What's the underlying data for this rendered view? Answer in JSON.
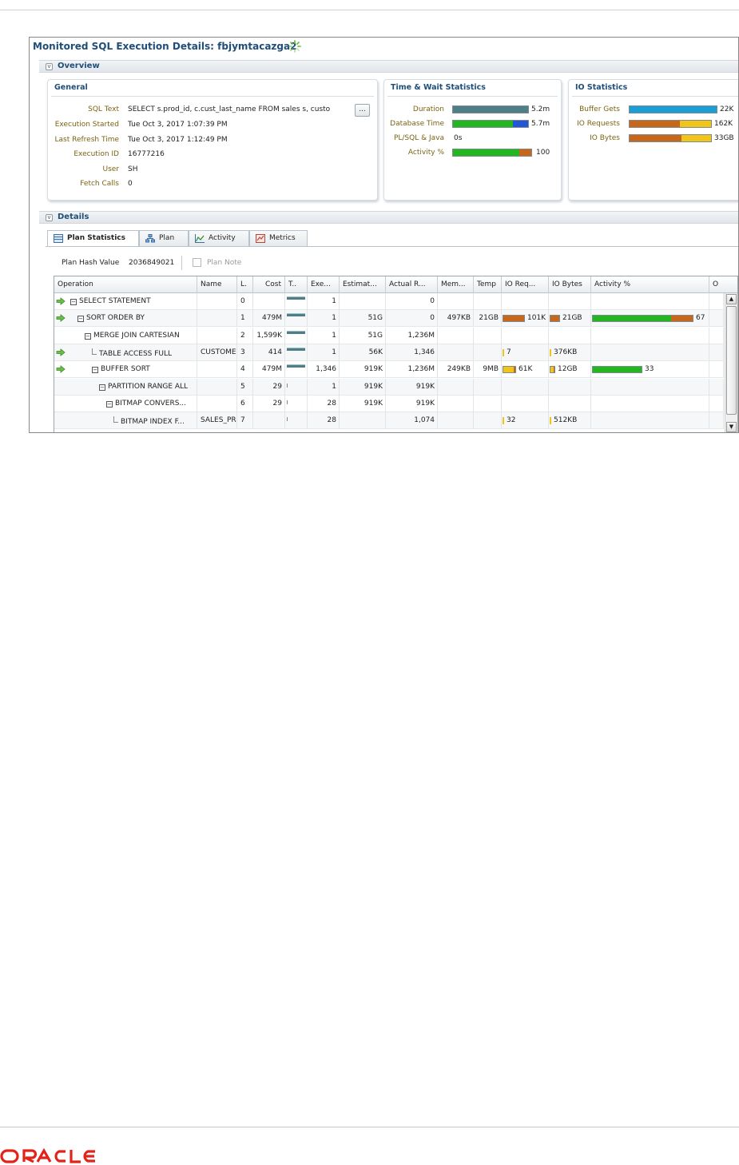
{
  "page": {
    "title": "Monitored SQL Execution Details: fbjymtacazga2",
    "overview_label": "Overview",
    "details_label": "Details"
  },
  "general": {
    "title": "General",
    "rows": [
      {
        "label": "SQL Text",
        "value": "SELECT s.prod_id, c.cust_last_name FROM sales s, custo"
      },
      {
        "label": "Execution Started",
        "value": "Tue Oct 3, 2017 1:07:39 PM"
      },
      {
        "label": "Last Refresh Time",
        "value": "Tue Oct 3, 2017 1:12:49 PM"
      },
      {
        "label": "Execution ID",
        "value": "16777216"
      },
      {
        "label": "User",
        "value": "SH"
      },
      {
        "label": "Fetch Calls",
        "value": "0"
      }
    ],
    "more_button": "..."
  },
  "time_wait": {
    "title": "Time & Wait Statistics",
    "rows": [
      {
        "label": "Duration",
        "value": "5.2m"
      },
      {
        "label": "Database Time",
        "value": "5.7m"
      },
      {
        "label": "PL/SQL & Java",
        "value": "0s"
      },
      {
        "label": "Activity %",
        "value": "100"
      }
    ]
  },
  "io_stats": {
    "title": "IO Statistics",
    "rows": [
      {
        "label": "Buffer Gets",
        "value": "22K"
      },
      {
        "label": "IO Requests",
        "value": "162K"
      },
      {
        "label": "IO Bytes",
        "value": "33GB"
      }
    ]
  },
  "colors": {
    "teal": "#4f7f86",
    "green": "#22b61f",
    "blue": "#2456d6",
    "orange": "#c8661a",
    "yellow": "#f0c419",
    "sky": "#1b9ed6"
  },
  "tabs": [
    {
      "label": "Plan Statistics",
      "icon": "table-icon"
    },
    {
      "label": "Plan",
      "icon": "tree-icon"
    },
    {
      "label": "Activity",
      "icon": "chart-icon"
    },
    {
      "label": "Metrics",
      "icon": "metrics-icon"
    }
  ],
  "plan": {
    "hash_label": "Plan Hash Value",
    "hash_value": "2036849021",
    "note_label": "Plan Note",
    "columns": [
      "Operation",
      "Name",
      "L.",
      "Cost",
      "T..",
      "Exe...",
      "Estimat...",
      "Actual R...",
      "Mem...",
      "Temp",
      "IO Req...",
      "IO Bytes",
      "Activity %",
      "O"
    ],
    "rows": [
      {
        "arrow": true,
        "tree": "box",
        "indent": 0,
        "op": "SELECT STATEMENT",
        "name": "",
        "line": "0",
        "cost": "",
        "timeline": 0.9,
        "exec": "1",
        "est": "",
        "actual": "0",
        "mem": "",
        "temp": "",
        "ioreq": "",
        "ioreq_frac": 0,
        "iobytes": "",
        "iobytes_frac": 0,
        "activity": "",
        "activity_frac": 0
      },
      {
        "arrow": true,
        "tree": "box",
        "indent": 1,
        "op": "SORT ORDER BY",
        "name": "",
        "line": "1",
        "cost": "479M",
        "timeline": 0.9,
        "exec": "1",
        "est": "51G",
        "actual": "0",
        "mem": "497KB",
        "temp": "21GB",
        "ioreq": "101K",
        "ioreq_frac": 0.62,
        "iobytes": "21GB",
        "iobytes_frac": 0.64,
        "activity": "67",
        "activity_frac": 0.67
      },
      {
        "arrow": false,
        "tree": "box",
        "indent": 2,
        "op": "MERGE JOIN CARTESIAN",
        "name": "",
        "line": "2",
        "cost": "1,599K",
        "timeline": 0.9,
        "exec": "1",
        "est": "51G",
        "actual": "1,236M",
        "mem": "",
        "temp": "",
        "ioreq": "",
        "ioreq_frac": 0,
        "iobytes": "",
        "iobytes_frac": 0,
        "activity": "",
        "activity_frac": 0
      },
      {
        "arrow": true,
        "tree": "line",
        "indent": 3,
        "op": "TABLE ACCESS FULL",
        "name": "CUSTOME",
        "line": "3",
        "cost": "414",
        "timeline": 0.9,
        "exec": "1",
        "est": "56K",
        "actual": "1,346",
        "mem": "",
        "temp": "",
        "ioreq": "7",
        "ioreq_frac": 0.0,
        "iobytes": "376KB",
        "iobytes_frac": 0.0,
        "activity": "",
        "activity_frac": 0
      },
      {
        "arrow": true,
        "tree": "box",
        "indent": 3,
        "op": "BUFFER SORT",
        "name": "",
        "line": "4",
        "cost": "479M",
        "timeline": 0.9,
        "exec": "1,346",
        "est": "919K",
        "actual": "1,236M",
        "mem": "249KB",
        "temp": "9MB",
        "ioreq": "61K",
        "ioreq_frac": 0.38,
        "iobytes": "12GB",
        "iobytes_frac": 0.36,
        "activity": "33",
        "activity_frac": 0.33
      },
      {
        "arrow": false,
        "tree": "box",
        "indent": 4,
        "op": "PARTITION RANGE ALL",
        "name": "",
        "line": "5",
        "cost": "29",
        "timeline": 0.0,
        "exec": "1",
        "est": "919K",
        "actual": "919K",
        "mem": "",
        "temp": "",
        "ioreq": "",
        "ioreq_frac": 0,
        "iobytes": "",
        "iobytes_frac": 0,
        "activity": "",
        "activity_frac": 0
      },
      {
        "arrow": false,
        "tree": "box",
        "indent": 5,
        "op": "BITMAP CONVERS...",
        "name": "",
        "line": "6",
        "cost": "29",
        "timeline": 0.0,
        "exec": "28",
        "est": "919K",
        "actual": "919K",
        "mem": "",
        "temp": "",
        "ioreq": "",
        "ioreq_frac": 0,
        "iobytes": "",
        "iobytes_frac": 0,
        "activity": "",
        "activity_frac": 0
      },
      {
        "arrow": false,
        "tree": "line",
        "indent": 6,
        "op": "BITMAP INDEX F...",
        "name": "SALES_PR",
        "line": "7",
        "cost": "",
        "timeline": 0.0,
        "exec": "28",
        "est": "",
        "actual": "1,074",
        "mem": "",
        "temp": "",
        "ioreq": "32",
        "ioreq_frac": 0.0,
        "iobytes": "512KB",
        "iobytes_frac": 0.0,
        "activity": "",
        "activity_frac": 0
      }
    ]
  }
}
